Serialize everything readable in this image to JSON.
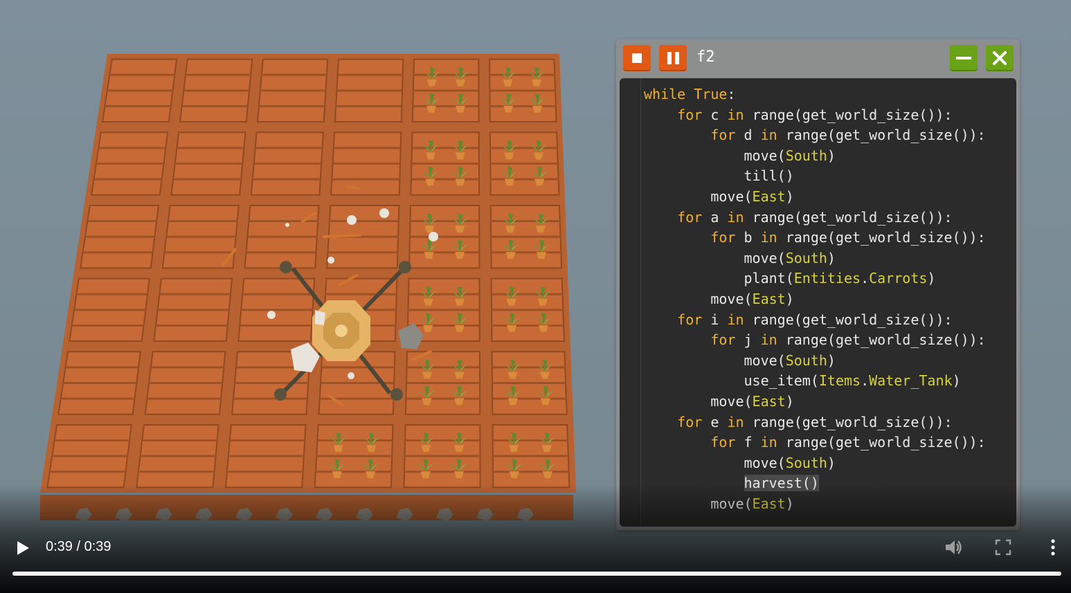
{
  "editor": {
    "title": "f2",
    "code_lines": [
      [
        {
          "t": "while ",
          "c": "kw"
        },
        {
          "t": "True",
          "c": "kw"
        },
        {
          "t": ":"
        }
      ],
      [
        {
          "t": "    "
        },
        {
          "t": "for ",
          "c": "kw"
        },
        {
          "t": "c "
        },
        {
          "t": "in ",
          "c": "kw"
        },
        {
          "t": "range(get_world_size()):"
        }
      ],
      [
        {
          "t": "        "
        },
        {
          "t": "for ",
          "c": "kw"
        },
        {
          "t": "d "
        },
        {
          "t": "in ",
          "c": "kw"
        },
        {
          "t": "range(get_world_size()):"
        }
      ],
      [
        {
          "t": "            move("
        },
        {
          "t": "South",
          "c": "ent"
        },
        {
          "t": ")"
        }
      ],
      [
        {
          "t": "            till()"
        }
      ],
      [
        {
          "t": "        move("
        },
        {
          "t": "East",
          "c": "ent"
        },
        {
          "t": ")"
        }
      ],
      [
        {
          "t": "    "
        },
        {
          "t": "for ",
          "c": "kw"
        },
        {
          "t": "a "
        },
        {
          "t": "in ",
          "c": "kw"
        },
        {
          "t": "range(get_world_size()):"
        }
      ],
      [
        {
          "t": "        "
        },
        {
          "t": "for ",
          "c": "kw"
        },
        {
          "t": "b "
        },
        {
          "t": "in ",
          "c": "kw"
        },
        {
          "t": "range(get_world_size()):"
        }
      ],
      [
        {
          "t": "            move("
        },
        {
          "t": "South",
          "c": "ent"
        },
        {
          "t": ")"
        }
      ],
      [
        {
          "t": "            plant("
        },
        {
          "t": "Entities",
          "c": "ent"
        },
        {
          "t": "."
        },
        {
          "t": "Carrots",
          "c": "ent"
        },
        {
          "t": ")"
        }
      ],
      [
        {
          "t": "        move("
        },
        {
          "t": "East",
          "c": "ent"
        },
        {
          "t": ")"
        }
      ],
      [
        {
          "t": "    "
        },
        {
          "t": "for ",
          "c": "kw"
        },
        {
          "t": "i "
        },
        {
          "t": "in ",
          "c": "kw"
        },
        {
          "t": "range(get_world_size()):"
        }
      ],
      [
        {
          "t": "        "
        },
        {
          "t": "for ",
          "c": "kw"
        },
        {
          "t": "j "
        },
        {
          "t": "in ",
          "c": "kw"
        },
        {
          "t": "range(get_world_size()):"
        }
      ],
      [
        {
          "t": "            move("
        },
        {
          "t": "South",
          "c": "ent"
        },
        {
          "t": ")"
        }
      ],
      [
        {
          "t": "            use_item("
        },
        {
          "t": "Items",
          "c": "ent"
        },
        {
          "t": "."
        },
        {
          "t": "Water_Tank",
          "c": "ent"
        },
        {
          "t": ")"
        }
      ],
      [
        {
          "t": "        move("
        },
        {
          "t": "East",
          "c": "ent"
        },
        {
          "t": ")"
        }
      ],
      [
        {
          "t": "    "
        },
        {
          "t": "for ",
          "c": "kw"
        },
        {
          "t": "e "
        },
        {
          "t": "in ",
          "c": "kw"
        },
        {
          "t": "range(get_world_size()):"
        }
      ],
      [
        {
          "t": "        "
        },
        {
          "t": "for ",
          "c": "kw"
        },
        {
          "t": "f "
        },
        {
          "t": "in ",
          "c": "kw"
        },
        {
          "t": "range(get_world_size()):"
        }
      ],
      [
        {
          "t": "            move("
        },
        {
          "t": "South",
          "c": "ent"
        },
        {
          "t": ")"
        }
      ],
      [
        {
          "t": "            "
        },
        {
          "t": "harvest()",
          "c": "hl"
        }
      ],
      [
        {
          "t": "        move("
        },
        {
          "t": "East",
          "c": "ent"
        },
        {
          "t": ")"
        }
      ]
    ],
    "icons": {
      "stop": "stop-icon",
      "pause": "pause-icon",
      "minimize": "minimize-icon",
      "close": "close-icon"
    }
  },
  "video": {
    "time_display": "0:39 / 0:39",
    "progress_fraction": 1.0,
    "icons": {
      "play": "play-icon",
      "volume": "volume-icon",
      "fullscreen": "fullscreen-icon",
      "more": "more-options-icon"
    }
  },
  "game": {
    "grid_cols": 6,
    "grid_rows": 6,
    "planted_cols": 2
  },
  "colors": {
    "background": "#7b8d99",
    "soil": "#b35c2c",
    "editor_frame": "#8d8f8f",
    "code_bg": "#2b2b2b",
    "keyword": "#f0b132",
    "entity": "#d8d23a",
    "stop_pause": "#e05a16",
    "window_buttons": "#6aa317"
  }
}
